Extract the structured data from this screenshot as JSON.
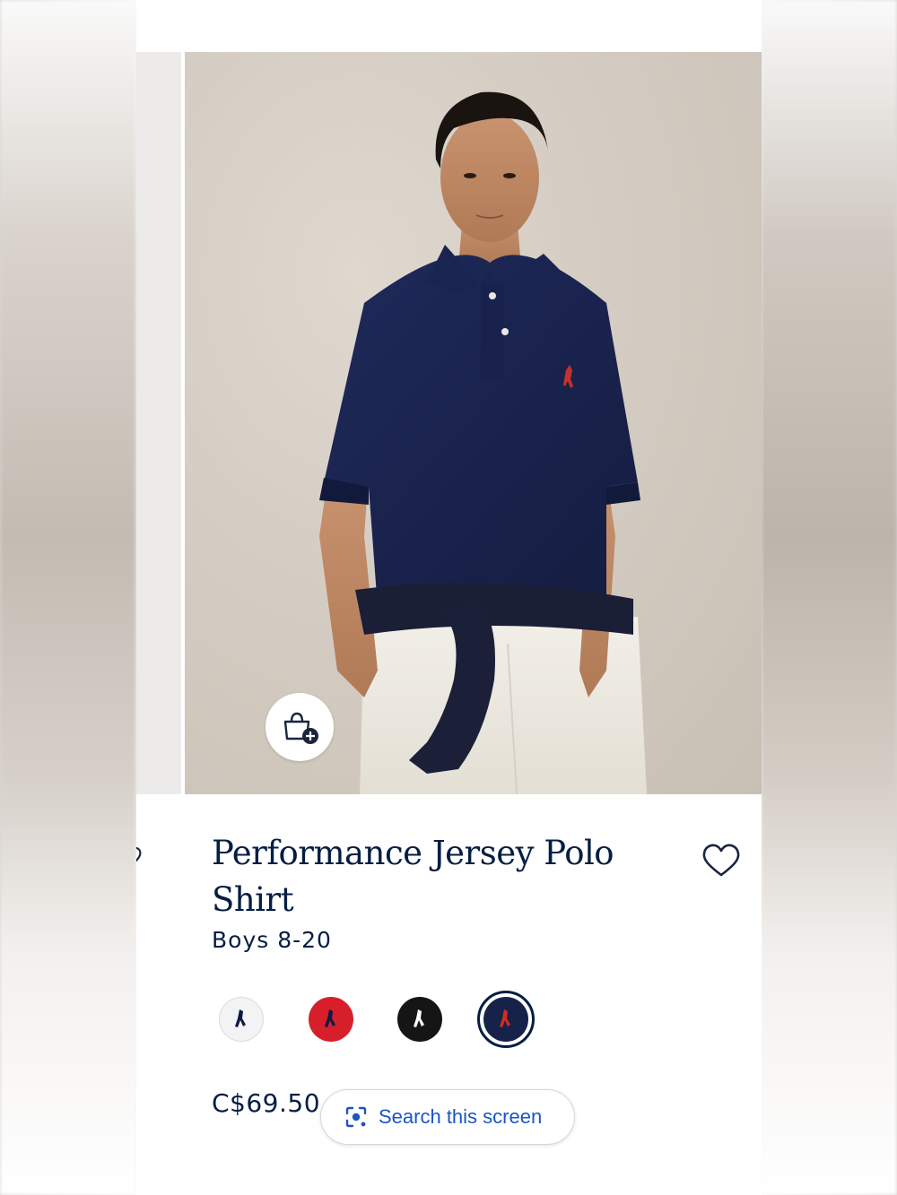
{
  "product": {
    "title": "Performance Jersey Polo Shirt",
    "subtitle": "Boys 8-20",
    "price": "C$69.50"
  },
  "swatches": [
    {
      "name": "white",
      "bg": "#f3f3f5",
      "logo": "#0d1a45"
    },
    {
      "name": "red",
      "bg": "#d61f2a",
      "logo": "#0d1a45"
    },
    {
      "name": "black",
      "bg": "#151515",
      "logo": "#ffffff"
    },
    {
      "name": "navy",
      "bg": "#16224a",
      "logo": "#d62a22",
      "selected": true
    }
  ],
  "search_pill": {
    "label": "Search this screen",
    "icon": "lens-icon"
  },
  "icons": {
    "add_to_bag": "bag-plus-icon",
    "wishlist": "heart-outline-icon"
  },
  "colors": {
    "brand_navy": "#041e42",
    "google_blue": "#1a56c4"
  }
}
